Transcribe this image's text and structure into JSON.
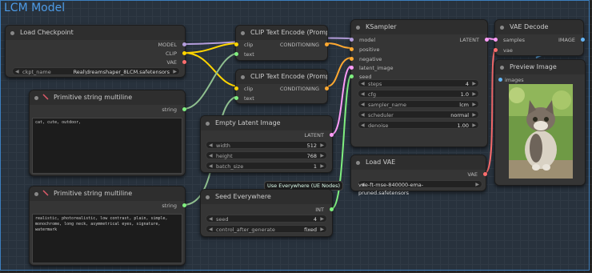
{
  "group": {
    "title": "LCM Model"
  },
  "colors": {
    "model": "#b39ddb",
    "clip": "#ffd500",
    "vae": "#ff6e6e",
    "conditioning": "#ffa931",
    "latent": "#ff9cf9",
    "string": "#7fef7f",
    "int": "#7fef7f",
    "image": "#64b5f6",
    "group": "#3d7fbf"
  },
  "nodes": {
    "load_checkpoint": {
      "title": "Load Checkpoint",
      "outputs": [
        "MODEL",
        "CLIP",
        "VAE"
      ],
      "widget": {
        "label": "ckpt_name",
        "value": "Real\\dreamshaper_8LCM.safetensors"
      }
    },
    "prompt_positive": {
      "title": "Primitive string multiline",
      "output": "string",
      "text": "cat, cute, outdoor,"
    },
    "prompt_negative": {
      "title": "Primitive string multiline",
      "output": "string",
      "text": "realistic, photorealistic, low contrast, plain, simple, monochrome, long neck, asymmetrical eyes, signature, watermark"
    },
    "clip_encode_1": {
      "title": "CLIP Text Encode (Prompt)",
      "inputs": [
        "clip",
        "text"
      ],
      "output": "CONDITIONING"
    },
    "clip_encode_2": {
      "title": "CLIP Text Encode (Prompt)",
      "inputs": [
        "clip",
        "text"
      ],
      "output": "CONDITIONING"
    },
    "empty_latent": {
      "title": "Empty Latent Image",
      "output": "LATENT",
      "widgets": [
        {
          "label": "width",
          "value": "512"
        },
        {
          "label": "height",
          "value": "768"
        },
        {
          "label": "batch_size",
          "value": "1"
        }
      ]
    },
    "seed_everywhere": {
      "title": "Seed Everywhere",
      "output": "INT",
      "badge": "Use Everywhere (UE Nodes)",
      "widgets": [
        {
          "label": "seed",
          "value": "4"
        },
        {
          "label": "control_after_generate",
          "value": "fixed"
        }
      ]
    },
    "ksampler": {
      "title": "KSampler",
      "inputs": [
        "model",
        "positive",
        "negative",
        "latent_image",
        "seed"
      ],
      "output": "LATENT",
      "widgets": [
        {
          "label": "steps",
          "value": "4"
        },
        {
          "label": "cfg",
          "value": "1.0"
        },
        {
          "label": "sampler_name",
          "value": "lcm"
        },
        {
          "label": "scheduler",
          "value": "normal"
        },
        {
          "label": "denoise",
          "value": "1.00"
        }
      ]
    },
    "load_vae": {
      "title": "Load VAE",
      "output": "VAE",
      "widget": {
        "label": "vae_name",
        "value": "vae-ft-mse-840000-ema-pruned.safetensors"
      }
    },
    "vae_decode": {
      "title": "VAE Decode",
      "inputs": [
        "samples",
        "vae"
      ],
      "output": "IMAGE"
    },
    "preview_image": {
      "title": "Preview Image",
      "input": "images"
    }
  }
}
